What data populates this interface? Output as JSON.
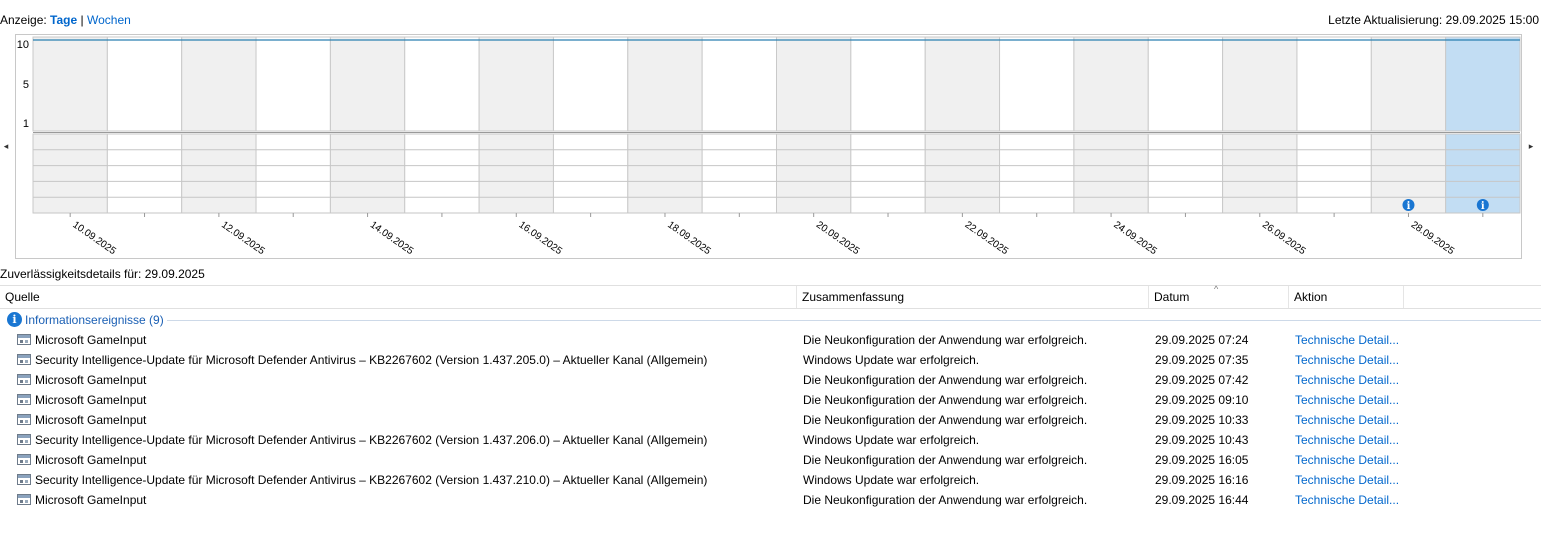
{
  "header": {
    "view_prefix": "Anzeige:",
    "view_days": "Tage",
    "separator": "|",
    "view_weeks": "Wochen",
    "last_update": "Letzte Aktualisierung: 29.09.2025 15:00"
  },
  "chart_data": {
    "type": "line",
    "y_ticks": [
      "10",
      "5",
      "1"
    ],
    "ylim": [
      1,
      10
    ],
    "x_tick_labels": [
      "10.09.2025",
      "12.09.2025",
      "14.09.2025",
      "16.09.2025",
      "18.09.2025",
      "20.09.2025",
      "22.09.2025",
      "24.09.2025",
      "26.09.2025",
      "28.09.2025"
    ],
    "stability_index_series": [
      10,
      10,
      10,
      10,
      10,
      10,
      10,
      10,
      10,
      10,
      10,
      10,
      10,
      10,
      10,
      10,
      10,
      10,
      10,
      10
    ],
    "day_count": 20,
    "event_rows": 5,
    "info_events_days": [
      "28.09.2025",
      "29.09.2025"
    ],
    "selected_day": "29.09.2025",
    "colors": {
      "shaded_column": "#f0f0f0",
      "selected_column": "#c2ddf3",
      "line": "#2a7fb0",
      "info_icon": "#1976d2"
    }
  },
  "navigation": {
    "left_arrow": "◂",
    "right_arrow": "▸"
  },
  "details": {
    "title": "Zuverlässigkeitsdetails für: 29.09.2025",
    "columns": [
      "Quelle",
      "Zusammenfassung",
      "Datum",
      "Aktion"
    ],
    "sort_indicator": "^",
    "group": {
      "icon": "info-icon",
      "label": "Informationsereignisse (9)"
    },
    "rows": [
      {
        "source": "Microsoft GameInput",
        "summary": "Die Neukonfiguration der Anwendung war erfolgreich.",
        "date": "29.09.2025 07:24",
        "action": "Technische Detail..."
      },
      {
        "source": "Security Intelligence-Update für Microsoft Defender Antivirus – KB2267602 (Version 1.437.205.0) – Aktueller Kanal (Allgemein)",
        "summary": "Windows Update war erfolgreich.",
        "date": "29.09.2025 07:35",
        "action": "Technische Detail..."
      },
      {
        "source": "Microsoft GameInput",
        "summary": "Die Neukonfiguration der Anwendung war erfolgreich.",
        "date": "29.09.2025 07:42",
        "action": "Technische Detail..."
      },
      {
        "source": "Microsoft GameInput",
        "summary": "Die Neukonfiguration der Anwendung war erfolgreich.",
        "date": "29.09.2025 09:10",
        "action": "Technische Detail..."
      },
      {
        "source": "Microsoft GameInput",
        "summary": "Die Neukonfiguration der Anwendung war erfolgreich.",
        "date": "29.09.2025 10:33",
        "action": "Technische Detail..."
      },
      {
        "source": "Security Intelligence-Update für Microsoft Defender Antivirus – KB2267602 (Version 1.437.206.0) – Aktueller Kanal (Allgemein)",
        "summary": "Windows Update war erfolgreich.",
        "date": "29.09.2025 10:43",
        "action": "Technische Detail..."
      },
      {
        "source": "Microsoft GameInput",
        "summary": "Die Neukonfiguration der Anwendung war erfolgreich.",
        "date": "29.09.2025 16:05",
        "action": "Technische Detail..."
      },
      {
        "source": "Security Intelligence-Update für Microsoft Defender Antivirus – KB2267602 (Version 1.437.210.0) – Aktueller Kanal (Allgemein)",
        "summary": "Windows Update war erfolgreich.",
        "date": "29.09.2025 16:16",
        "action": "Technische Detail..."
      },
      {
        "source": "Microsoft GameInput",
        "summary": "Die Neukonfiguration der Anwendung war erfolgreich.",
        "date": "29.09.2025 16:44",
        "action": "Technische Detail..."
      }
    ]
  }
}
